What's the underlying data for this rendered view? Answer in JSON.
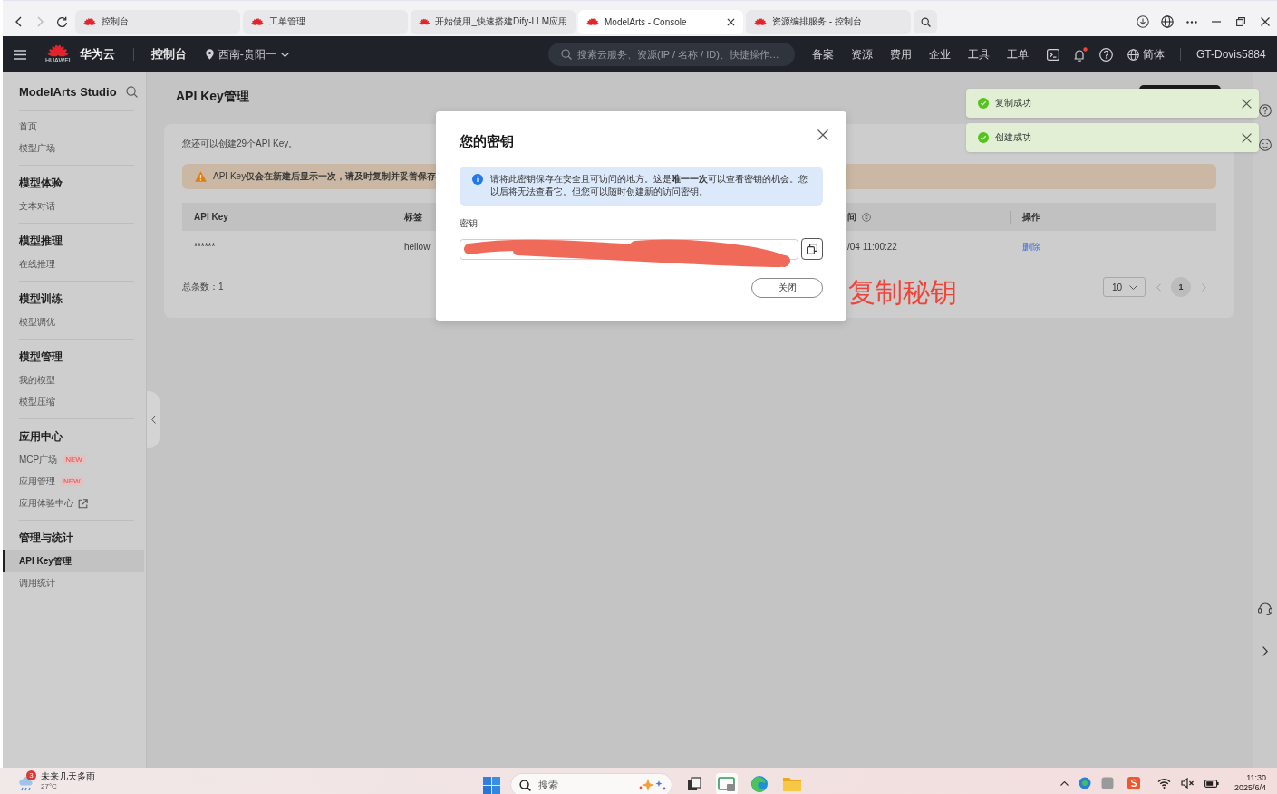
{
  "browser": {
    "nav_buttons": [
      {
        "kind": "back",
        "disabled": false
      },
      {
        "kind": "forward",
        "disabled": true
      },
      {
        "kind": "reload",
        "disabled": false
      }
    ],
    "tabs": [
      {
        "title": "控制台",
        "selected": false
      },
      {
        "title": "工单管理",
        "selected": false
      },
      {
        "title": "开始使用_快速搭建Dify-LLM应用",
        "selected": false
      },
      {
        "title": "ModelArts - Console",
        "selected": true
      },
      {
        "title": "资源编排服务 - 控制台",
        "selected": false
      }
    ]
  },
  "topnav": {
    "logo_caption": "HUAWEI",
    "brand": "华为云",
    "console": "控制台",
    "region": "西南-贵阳一",
    "search": {
      "placeholder": "搜索云服务、资源(IP / 名称 / ID)、快捷操作…"
    },
    "links": [
      "备案",
      "资源",
      "费用",
      "企业",
      "工具",
      "工单"
    ],
    "notifications_unread": true,
    "language": "简体",
    "user": "GT-Dovis5884"
  },
  "sidebar": {
    "title": "ModelArts Studio",
    "sections": [
      {
        "items": [
          {
            "label": "首页",
            "selected": false,
            "external": false
          },
          {
            "label": "模型广场",
            "selected": false,
            "external": false
          }
        ]
      },
      {
        "heading": "模型体验",
        "items": [
          {
            "label": "文本对话",
            "selected": false,
            "external": false
          }
        ]
      },
      {
        "heading": "模型推理",
        "items": [
          {
            "label": "在线推理",
            "selected": false,
            "external": false
          }
        ]
      },
      {
        "heading": "模型训练",
        "items": [
          {
            "label": "模型调优",
            "selected": false,
            "external": false
          }
        ]
      },
      {
        "heading": "模型管理",
        "items": [
          {
            "label": "我的模型",
            "selected": false,
            "external": false
          },
          {
            "label": "模型压缩",
            "selected": false,
            "external": false
          }
        ]
      },
      {
        "heading": "应用中心",
        "items": [
          {
            "label": "MCP广场",
            "badge": "NEW",
            "selected": false,
            "external": false
          },
          {
            "label": "应用管理",
            "badge": "NEW",
            "selected": false,
            "external": false
          },
          {
            "label": "应用体验中心",
            "selected": false,
            "external": true
          }
        ]
      },
      {
        "heading": "管理与统计",
        "items": [
          {
            "label": "API Key管理",
            "selected": true,
            "external": false
          },
          {
            "label": "调用统计",
            "selected": false,
            "external": false
          }
        ]
      }
    ]
  },
  "page": {
    "title": "API Key管理",
    "quota_note": "您还可以创建29个API Key。",
    "warning": "API Key**仅会在新建后显示一次，请及时复制并妥善保存**",
    "table": {
      "columns": [
        {
          "label": "API Key",
          "kind": "plain"
        },
        {
          "label": "标签",
          "kind": "plain"
        },
        {
          "label": "间",
          "kind": "sortable"
        },
        {
          "label": "操作",
          "kind": "plain"
        }
      ],
      "rows": [
        {
          "cells": [
            {
              "kind": "text",
              "text": "******"
            },
            {
              "kind": "text",
              "text": "hellow"
            },
            {
              "kind": "text",
              "text": "/04 11:00:22"
            },
            {
              "kind": "link",
              "text": "删除"
            }
          ]
        }
      ]
    },
    "total": "总条数：1",
    "pagination": {
      "page_size": "10",
      "pages": [
        {
          "label": "1",
          "selected": true
        }
      ],
      "prev_disabled": true,
      "next_disabled": true
    }
  },
  "dialog": {
    "title": "您的密钥",
    "info": "请将此密钥保存在安全且可访问的地方。这是**唯一一次**可以查看密钥的机会。您以后将无法查看它。但您可以随时创建新的访问密钥。",
    "field_label": "密钥",
    "close_label": "关闭"
  },
  "toasts": [
    {
      "kind": "success",
      "text": "复制成功"
    },
    {
      "kind": "success",
      "text": "创建成功"
    }
  ],
  "annotation": "复制秘钥",
  "taskbar": {
    "weather": {
      "alerts": "3",
      "forecast": "未来几天多雨",
      "temperature": "27°C"
    },
    "search": {
      "placeholder": "搜索"
    },
    "apps": [
      {
        "kind": "task-view",
        "active": false
      },
      {
        "kind": "window",
        "active": true
      },
      {
        "kind": "browser",
        "active": false
      },
      {
        "kind": "folder",
        "active": false
      }
    ],
    "time": "11:30",
    "date": "2025/6/4"
  }
}
